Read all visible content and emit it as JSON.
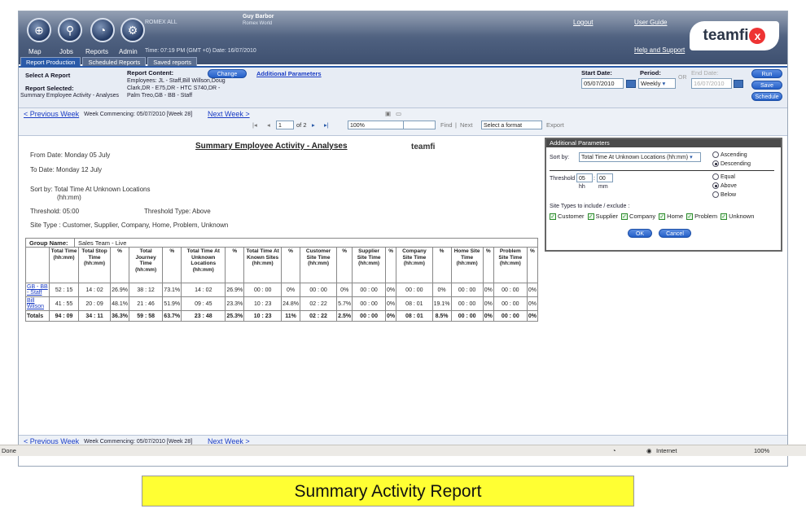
{
  "header": {
    "user_name": "Guy Barbor",
    "user_org": "Romex World",
    "org_label": "ROMEX ALL",
    "time_text": "Time: 07:19 PM (GMT +0)  Date: 16/07/2010",
    "nav": [
      "Map",
      "Jobs",
      "Reports",
      "Admin"
    ],
    "logout": "Logout",
    "user_guide": "User Guide",
    "help": "Help and Support",
    "logo": "teamfi",
    "logo_x": "x"
  },
  "tabs": [
    "Report Production",
    "Scheduled Reports",
    "Saved reports"
  ],
  "report_panel": {
    "select_label": "Select A Report",
    "selected_label": "Report Selected:",
    "selected_value": "Summary Employee Activity - Analyses",
    "content_label": "Report Content:",
    "change_btn": "Change",
    "additional_link": "Additional Parameters",
    "content_text": "Employees: JL - Staff,Bill Willson,Doug Clark,DR - E75,DR - HTC S740,DR - Palm Treo,GB - BB - Staff",
    "start_label": "Start Date:",
    "start_value": "05/07/2010",
    "period_label": "Period:",
    "period_value": "Weekly",
    "or": "OR",
    "end_label": "End Date:",
    "end_value": "16/07/2010",
    "run": "Run",
    "save": "Save",
    "schedule": "Schedule"
  },
  "weeknav": {
    "prev": "< Previous Week",
    "commencing": "Week Commencing: 05/07/2010 [Week 28]",
    "next": "Next Week >",
    "page": "1",
    "of": "of 2",
    "zoom": "100%",
    "find": "Find",
    "next_find": "Next",
    "format": "Select a format",
    "export": "Export"
  },
  "report": {
    "title": "Summary Employee Activity - Analyses",
    "brand": "teamfi",
    "from": "From Date:  Monday 05 July",
    "to": "To Date:  Monday 12 July",
    "sort_a": "Sort by:  Total Time At Unknown Locations",
    "sort_b": "(hh:mm)",
    "threshold": "Threshold:  05:00",
    "threshold_type": "Threshold Type:  Above",
    "site_type": "Site Type :        Customer, Supplier, Company, Home, Problem, Unknown",
    "group_label": "Group Name:",
    "group_value": "Sales Team - Live",
    "columns": [
      "",
      "Total Time (hh:mm)",
      "Total Stop Time (hh:mm)",
      "%",
      "Total Journey Time (hh:mm)",
      "%",
      "Total Time At Unknown Locations (hh:mm)",
      "%",
      "Total Time At Known Sites (hh:mm)",
      "%",
      "Customer Site Time (hh:mm)",
      "%",
      "Supplier Site Time (hh:mm)",
      "%",
      "Company Site Time (hh:mm)",
      "%",
      "Home Site Time (hh:mm)",
      "%",
      "Problem Site Time (hh:mm)",
      "%"
    ],
    "rows": [
      [
        "GB - BB - Staff",
        "52 : 15",
        "14 : 02",
        "26.9%",
        "38 : 12",
        "73.1%",
        "14 : 02",
        "26.9%",
        "00 : 00",
        "0%",
        "00 : 00",
        "0%",
        "00 : 00",
        "0%",
        "00 : 00",
        "0%",
        "00 : 00",
        "0%",
        "00 : 00",
        "0%"
      ],
      [
        "Bill Wilson",
        "41 : 55",
        "20 : 09",
        "48.1%",
        "21 : 46",
        "51.9%",
        "09 : 45",
        "23.3%",
        "10 : 23",
        "24.8%",
        "02 : 22",
        "5.7%",
        "00 : 00",
        "0%",
        "08 : 01",
        "19.1%",
        "00 : 00",
        "0%",
        "00 : 00",
        "0%"
      ],
      [
        "Totals",
        "94 : 09",
        "34 : 11",
        "36.3%",
        "59 : 58",
        "63.7%",
        "23 : 48",
        "25.3%",
        "10 : 23",
        "11%",
        "02 : 22",
        "2.5%",
        "00 : 00",
        "0%",
        "08 : 01",
        "8.5%",
        "00 : 00",
        "0%",
        "00 : 00",
        "0%"
      ]
    ]
  },
  "params": {
    "title": "Additional Parameters",
    "sort_label": "Sort by:",
    "sort_value": "Total Time At Unknown Locations (hh:mm)",
    "asc": "Ascending",
    "desc": "Descending",
    "threshold_label": "Threshold",
    "hh_value": "05",
    "mm_value": "00",
    "hh": "hh",
    "mm": "mm",
    "equal": "Equal",
    "above": "Above",
    "below": "Below",
    "site_types_label": "Site Types to include / exclude :",
    "site_types": [
      "Customer",
      "Supplier",
      "Company",
      "Home",
      "Problem",
      "Unknown"
    ],
    "ok": "OK",
    "cancel": "Cancel"
  },
  "status": {
    "done": "Done",
    "zone": "Internet",
    "zoom": "100%"
  },
  "caption": "Summary Activity Report"
}
